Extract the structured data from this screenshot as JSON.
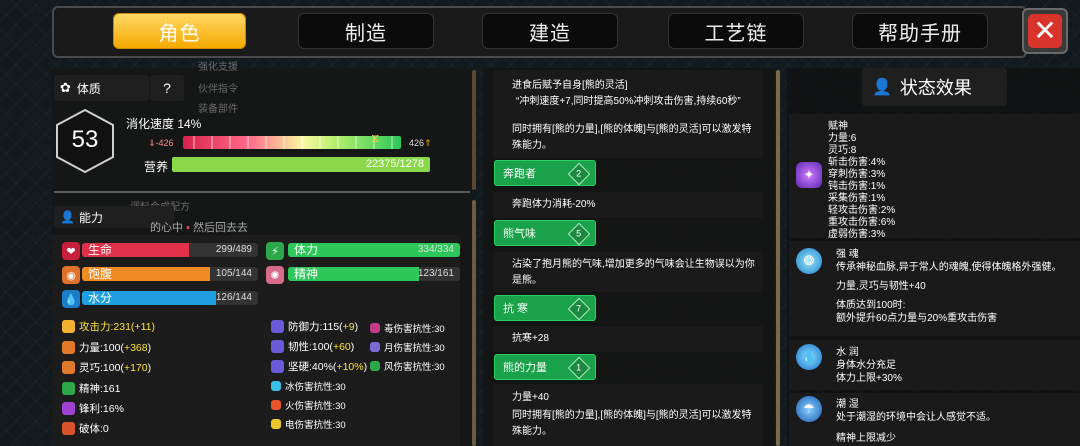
{
  "tabs": [
    {
      "label": "角色",
      "active": true
    },
    {
      "label": "制造",
      "active": false
    },
    {
      "label": "建造",
      "active": false
    },
    {
      "label": "工艺链",
      "active": false
    },
    {
      "label": "帮助手册",
      "active": false
    }
  ],
  "close_icon": "close-icon",
  "constitution": {
    "header": "体质",
    "help": "?",
    "level": "53",
    "digest_label": "消化速度 14%",
    "digest_min": "-426",
    "digest_max": "426",
    "nutrition_label": "营养",
    "nutrition_value": "22375/1278",
    "nutrition_fill": 1.0
  },
  "abilities": {
    "header": "能力",
    "bars": [
      {
        "label": "生命",
        "value": "299/489",
        "fill": 0.61,
        "color": "#e0304a",
        "icon": "heart-icon"
      },
      {
        "label": "饱腹",
        "value": "105/144",
        "fill": 0.73,
        "color": "#f08a22",
        "icon": "meat-icon"
      },
      {
        "label": "水分",
        "value": "126/144",
        "fill": 0.875,
        "color": "#1f9ee0",
        "icon": "water-drop-icon"
      },
      {
        "label": "体力",
        "value": "334/334",
        "fill": 1.0,
        "color": "#2cc85a",
        "icon": "lightning-icon"
      },
      {
        "label": "精神",
        "value": "123/161",
        "fill": 0.76,
        "color": "#2cc85a",
        "icon": "brain-icon"
      }
    ],
    "attrs_col1": [
      {
        "text": "攻击力:231(+11)",
        "color": "#ffe23a",
        "icon_color": "#f2b12e",
        "icon": "fist-icon"
      },
      {
        "text": "力量:100(+368)",
        "color": "#ffffff",
        "icon_color": "#e07a2a",
        "icon": "arm-icon"
      },
      {
        "text": "灵巧:100(+170)",
        "color": "#ffffff",
        "icon_color": "#e07a2a",
        "icon": "hand-icon"
      },
      {
        "text": "精神:161",
        "color": "#ffffff",
        "icon_color": "#2ca84a",
        "icon": "pulse-icon"
      },
      {
        "text": "锋利:16%",
        "color": "#ffffff",
        "icon_color": "#a040d0",
        "icon": "blade-icon"
      },
      {
        "text": "破体:0",
        "color": "#ffffff",
        "icon_color": "#d8542a",
        "icon": "break-icon"
      }
    ],
    "attrs_col2": [
      {
        "text": "防御力:115(+9)",
        "color": "#ffe23a",
        "icon_color": "#6a5ad8",
        "icon": "shield-icon"
      },
      {
        "text": "韧性:100(+60)",
        "color": "#ffffff",
        "icon_color": "#6a5ad8",
        "icon": "toughness-icon"
      },
      {
        "text": "坚硬:40%(+10%)",
        "color": "#ffffff",
        "icon_color": "#6a5ad8",
        "icon": "hardness-icon"
      },
      {
        "text": "冰伤害抗性:30",
        "color": "#ffffff",
        "icon_color": "#3ac0e8",
        "icon": "ice-icon"
      },
      {
        "text": "火伤害抗性:30",
        "color": "#ffffff",
        "icon_color": "#e8542a",
        "icon": "fire-icon"
      },
      {
        "text": "电伤害抗性:30",
        "color": "#ffffff",
        "icon_color": "#e8c82a",
        "icon": "electric-icon"
      }
    ],
    "attrs_col3": [
      {
        "text": "毒伤害抗性:30",
        "color": "#ffffff",
        "icon_color": "#c23a8a",
        "icon": "poison-icon"
      },
      {
        "text": "月伤害抗性:30",
        "color": "#ffffff",
        "icon_color": "#7a6ad8",
        "icon": "moon-icon"
      },
      {
        "text": "风伤害抗性:30",
        "color": "#ffffff",
        "icon_color": "#2ca84a",
        "icon": "wind-icon"
      }
    ],
    "bg_fragments": [
      "强化支援",
      "伙伴指令",
      "装备部件",
      "调料合成配方",
      "的心中",
      "然后回去去"
    ]
  },
  "middle": {
    "intro": [
      "进食后赋予自身[熊的灵活]",
      "“冲刺速度+7,同时提高50%冲刺攻击伤害,持续60秒”"
    ],
    "combo": [
      "同时拥有[熊的力量],[熊的体魄]与[熊的灵活]可以激发特",
      "殊能力。"
    ],
    "traits": [
      {
        "name": "奔跑者",
        "level": "2",
        "desc": [
          "奔跑体力消耗-20%"
        ]
      },
      {
        "name": "熊气味",
        "level": "5",
        "desc": [
          "沾染了抱月熊的气味,增加更多的气味会让生物误以为你",
          "是熊。"
        ]
      },
      {
        "name": "抗 寒",
        "level": "7",
        "desc": [
          "抗寒+28"
        ]
      },
      {
        "name": "熊的力量",
        "level": "1",
        "desc": [
          "力量+40",
          "同时拥有[熊的力量],[熊的体魄]与[熊的灵活]可以激发特",
          "殊能力。"
        ]
      }
    ]
  },
  "status": {
    "header": "状态效果",
    "effects": [
      {
        "name": "赋神",
        "icon": "purple-spirit-icon",
        "lines": [
          "力量:6",
          "灵巧:8",
          "斩击伤害:4%",
          "穿刺伤害:3%",
          "钝击伤害:1%",
          "采集伤害:1%",
          "轻攻击伤害:2%",
          "重攻击伤害:6%",
          "虚弱伤害:3%"
        ]
      },
      {
        "name": "强 魂",
        "icon": "soul-icon",
        "lines": [
          "传承神秘血脉,异于常人的魂魄,使得体魄格外强健。",
          "",
          "力量,灵巧与韧性+40",
          "",
          "体质达到100时:",
          "额外提升60点力量与20%重攻击伤害"
        ]
      },
      {
        "name": "水 润",
        "icon": "water-icon",
        "lines": [
          "身体水分充足",
          "体力上限+30%"
        ]
      },
      {
        "name": "潮 湿",
        "icon": "damp-icon",
        "lines": [
          "处于潮湿的环境中会让人感觉不适。",
          "",
          "精神上限减少"
        ]
      }
    ]
  }
}
